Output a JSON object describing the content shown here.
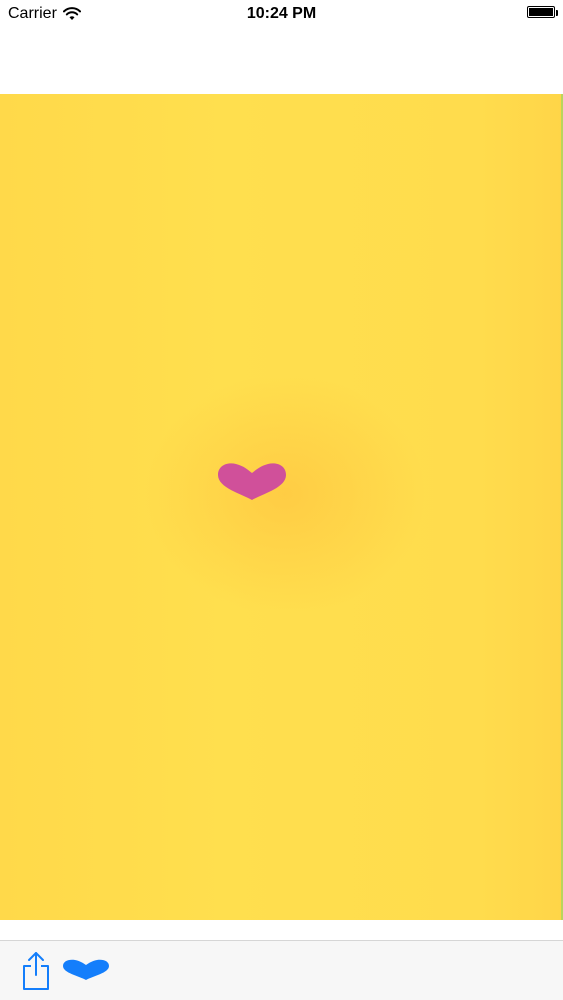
{
  "status_bar": {
    "carrier": "Carrier",
    "time": "10:24 PM",
    "icons": {
      "wifi": "wifi-icon",
      "battery": "battery-icon"
    }
  },
  "canvas": {
    "colors": {
      "background": "#ffdc4d",
      "glow": "#ffbe3c",
      "heart": "#d0509a"
    },
    "icons": {
      "center": "heart-icon"
    }
  },
  "toolbar": {
    "icons": {
      "share": "share-icon",
      "heart": "heart-icon"
    },
    "colors": {
      "accent": "#147efb"
    }
  }
}
